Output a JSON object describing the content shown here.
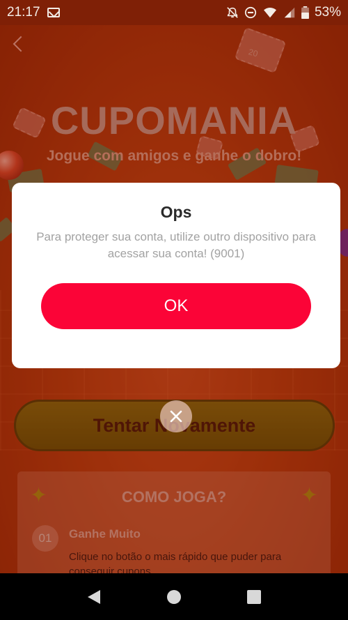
{
  "status_bar": {
    "time": "21:17",
    "battery": "53%",
    "icons": [
      "gmail-icon",
      "mute-icon",
      "do-not-disturb-icon",
      "wifi-icon",
      "signal-icon",
      "battery-icon"
    ]
  },
  "game": {
    "title": "CUPOMANIA",
    "subtitle": "Jogue com amigos e ganhe o dobro!",
    "coupon_value": "20",
    "retry_label": "Tentar Novamente",
    "howto": {
      "title": "COMO JOGA?",
      "step_number": "01",
      "step_title": "Ganhe Muito",
      "step_desc": "Clique no botão o mais rápido que puder para conseguir cupons"
    }
  },
  "dialog": {
    "title": "Ops",
    "message": "Para proteger sua conta, utilize outro dispositivo para acessar sua conta! (9001)",
    "ok_label": "OK"
  },
  "colors": {
    "background": "#b8320c",
    "ok_button": "#fb0437",
    "retry_button": "#8a6d0e",
    "dialog_bg": "#ffffff"
  }
}
